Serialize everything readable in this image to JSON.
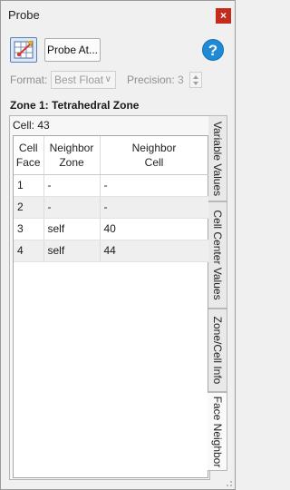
{
  "window": {
    "title": "Probe",
    "close_glyph": "×"
  },
  "toolbar": {
    "probe_icon": "probe-grid-icon",
    "probe_at_label": "Probe At...",
    "help_glyph": "?"
  },
  "format": {
    "label": "Format:",
    "value": "Best Float"
  },
  "precision": {
    "label": "Precision:",
    "value": "3"
  },
  "zone_title": "Zone 1: Tetrahedral Zone",
  "cell_label": "Cell: 43",
  "table": {
    "headers": [
      [
        "Cell",
        "Face"
      ],
      [
        "Neighbor",
        "Zone"
      ],
      [
        "Neighbor",
        "Cell"
      ]
    ],
    "rows": [
      [
        "1",
        "-",
        "-"
      ],
      [
        "2",
        "-",
        "-"
      ],
      [
        "3",
        "self",
        "40"
      ],
      [
        "4",
        "self",
        "44"
      ]
    ]
  },
  "tabs": [
    {
      "label": "Variable Values",
      "active": false
    },
    {
      "label": "Cell Center Values",
      "active": false
    },
    {
      "label": "Zone/Cell Info",
      "active": false
    },
    {
      "label": "Face Neighbor",
      "active": true
    }
  ]
}
